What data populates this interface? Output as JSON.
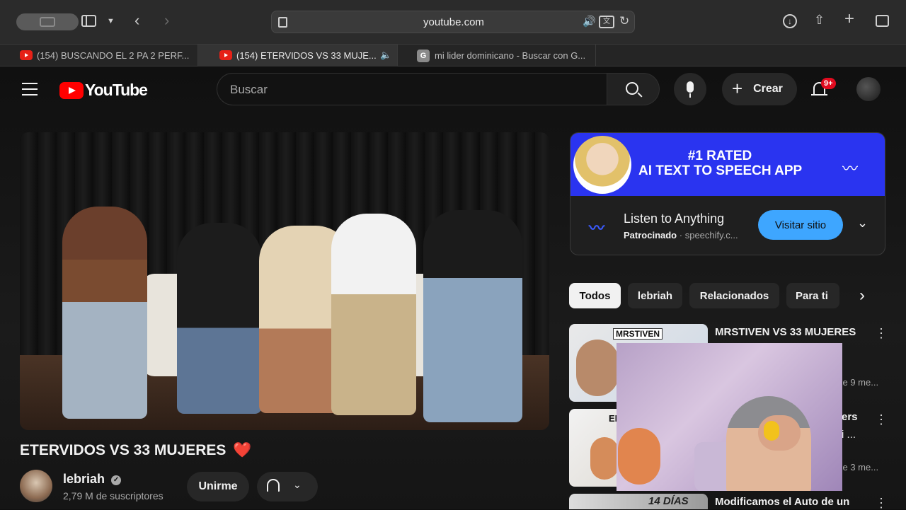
{
  "browser": {
    "url": "youtube.com",
    "tabs": [
      {
        "label": "(154) BUSCANDO EL 2 PA 2 PERF..."
      },
      {
        "label": "(154) ETERVIDOS VS 33 MUJE..."
      },
      {
        "label": "mi lider dominicano - Buscar con G...",
        "favicon_letter": "G"
      }
    ]
  },
  "header": {
    "logo_text": "YouTube",
    "search_placeholder": "Buscar",
    "create_label": "Crear",
    "notifications_badge": "9+"
  },
  "video": {
    "title": "ETERVIDOS VS 33 MUJERES",
    "title_emoji": "❤️",
    "channel_name": "lebriah",
    "subscribers": "2,79 M de suscriptores",
    "join_label": "Unirme"
  },
  "ad": {
    "banner_line1": "#1 RATED",
    "banner_line2": "AI TEXT TO SPEECH APP",
    "headline": "Listen to Anything",
    "sponsored": "Patrocinado",
    "domain": "speechify.c...",
    "cta": "Visitar sitio",
    "brand_color": "#2a34f0"
  },
  "chips": [
    {
      "label": "Todos"
    },
    {
      "label": "lebriah"
    },
    {
      "label": "Relacionados"
    },
    {
      "label": "Para ti"
    }
  ],
  "recommendations": [
    {
      "title": "MRSTIVEN VS 33 MUJERES",
      "thumb_tag": "MRSTIVEN",
      "meta": "ce 9 me..."
    },
    {
      "title": "ers",
      "title2": "i ...",
      "thumb_tag": "EL",
      "meta": "ce 3 me..."
    },
    {
      "title": "Modificamos el Auto de un",
      "thumb_tag": "14 DÍAS"
    }
  ]
}
